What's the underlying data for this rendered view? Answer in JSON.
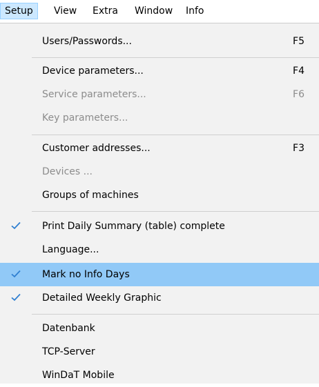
{
  "menubar": {
    "items": [
      {
        "label": "Setup"
      },
      {
        "label": "View"
      },
      {
        "label": "Extra"
      },
      {
        "label": "Window"
      },
      {
        "label": "Info"
      }
    ]
  },
  "menu": {
    "items": [
      {
        "label": "Users/Passwords...",
        "shortcut": "F5",
        "enabled": true,
        "checked": false
      },
      {
        "label": "Device parameters...",
        "shortcut": "F4",
        "enabled": true,
        "checked": false
      },
      {
        "label": "Service parameters...",
        "shortcut": "F6",
        "enabled": false,
        "checked": false
      },
      {
        "label": "Key parameters...",
        "shortcut": "",
        "enabled": false,
        "checked": false
      },
      {
        "label": "Customer addresses...",
        "shortcut": "F3",
        "enabled": true,
        "checked": false
      },
      {
        "label": "Devices ...",
        "shortcut": "",
        "enabled": false,
        "checked": false
      },
      {
        "label": "Groups of machines",
        "shortcut": "",
        "enabled": true,
        "checked": false
      },
      {
        "label": "Print Daily Summary (table) complete",
        "shortcut": "",
        "enabled": true,
        "checked": true
      },
      {
        "label": "Language...",
        "shortcut": "",
        "enabled": true,
        "checked": false
      },
      {
        "label": "Mark no Info Days",
        "shortcut": "",
        "enabled": true,
        "checked": true,
        "highlighted": true
      },
      {
        "label": "Detailed Weekly Graphic",
        "shortcut": "",
        "enabled": true,
        "checked": true
      },
      {
        "label": "Datenbank",
        "shortcut": "",
        "enabled": true,
        "checked": false
      },
      {
        "label": "TCP-Server",
        "shortcut": "",
        "enabled": true,
        "checked": false
      },
      {
        "label": "WinDaT Mobile",
        "shortcut": "",
        "enabled": true,
        "checked": false
      }
    ],
    "check_icon": "checkmark-icon",
    "colors": {
      "highlight": "#91c9f7",
      "disabled_text": "#8c8c8c",
      "check": "#2f7fd1",
      "menu_background": "#f2f2f2"
    }
  }
}
